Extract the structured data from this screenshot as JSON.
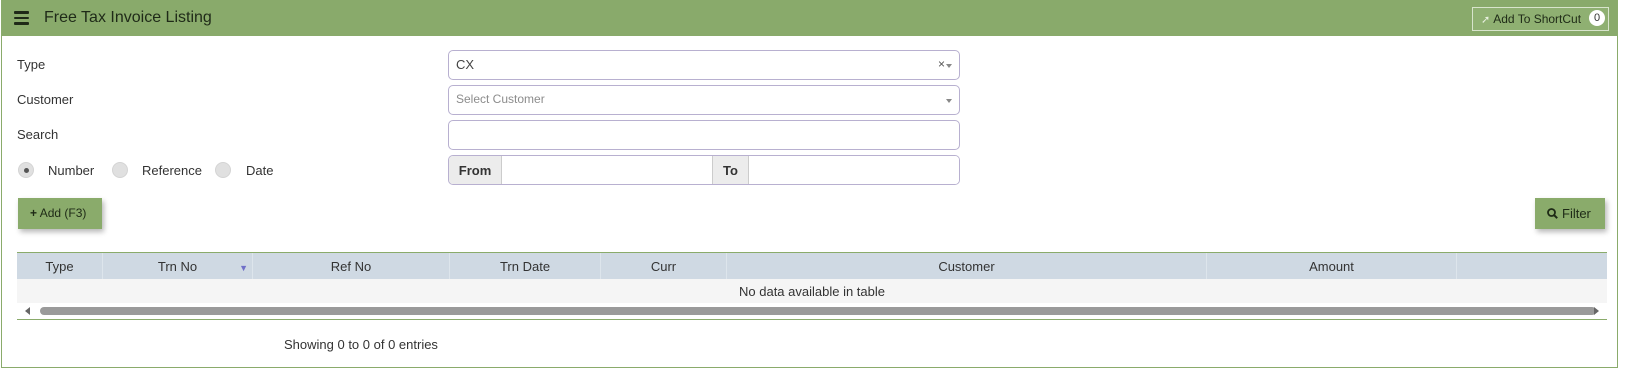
{
  "header": {
    "title": "Free Tax Invoice Listing",
    "shortcut_label": "Add To ShortCut",
    "shortcut_count": "0"
  },
  "form": {
    "type_label": "Type",
    "type_value": "CX",
    "type_clear": "×",
    "customer_label": "Customer",
    "customer_placeholder": "Select Customer",
    "search_label": "Search",
    "search_value": "",
    "radios": [
      {
        "label": "Number",
        "checked": true
      },
      {
        "label": "Reference",
        "checked": false
      },
      {
        "label": "Date",
        "checked": false
      }
    ],
    "from_label": "From",
    "to_label": "To",
    "from_value": "",
    "to_value": ""
  },
  "actions": {
    "add_label": "Add (F3)",
    "add_icon": "plus-icon",
    "filter_label": "Filter",
    "filter_icon": "search-icon"
  },
  "table": {
    "columns": [
      "Type",
      "Trn No",
      "Ref No",
      "Trn Date",
      "Curr",
      "Customer",
      "Amount"
    ],
    "sorted_column": "Trn No",
    "empty_message": "No data available in table"
  },
  "footer": {
    "info": "Showing 0 to 0 of 0 entries"
  },
  "colors": {
    "header_bg": "#89aa6b",
    "button_bg": "#8aab6b",
    "table_header_bg": "#cfd9e3",
    "border_green": "#8aab6b"
  }
}
